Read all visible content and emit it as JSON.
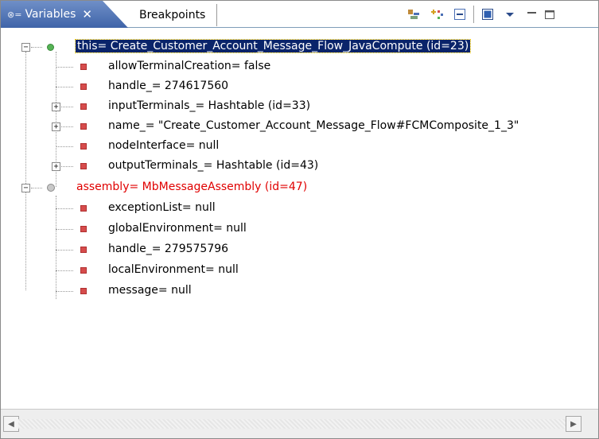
{
  "tabs": [
    {
      "label": "Variables",
      "active": true
    },
    {
      "label": "Breakpoints",
      "active": false
    }
  ],
  "toolbar": {
    "close_glyph": "✕"
  },
  "tree": {
    "nodes": [
      {
        "label": "this= Create_Customer_Account_Message_Flow_JavaCompute  (id=23)",
        "selected": true
      },
      {
        "label": "allowTerminalCreation= false"
      },
      {
        "label": "handle_= 274617560"
      },
      {
        "label": "inputTerminals_= Hashtable  (id=33)"
      },
      {
        "label": "name_= \"Create_Customer_Account_Message_Flow#FCMComposite_1_3\""
      },
      {
        "label": "nodeInterface= null"
      },
      {
        "label": "outputTerminals_= Hashtable  (id=43)"
      },
      {
        "label": "assembly= MbMessageAssembly  (id=47)",
        "color": "#e00000"
      },
      {
        "label": "exceptionList= null"
      },
      {
        "label": "globalEnvironment= null"
      },
      {
        "label": "handle_= 279575796"
      },
      {
        "label": "localEnvironment= null"
      },
      {
        "label": "message= null"
      }
    ],
    "expander_collapsed": "+",
    "expander_expanded": "−"
  },
  "scrollbar": {
    "left_arrow": "◀",
    "right_arrow": "▶"
  },
  "colors": {
    "selection": "#0a246a",
    "red_node": "#e00000",
    "tab_blue": "#4a6fb5"
  }
}
